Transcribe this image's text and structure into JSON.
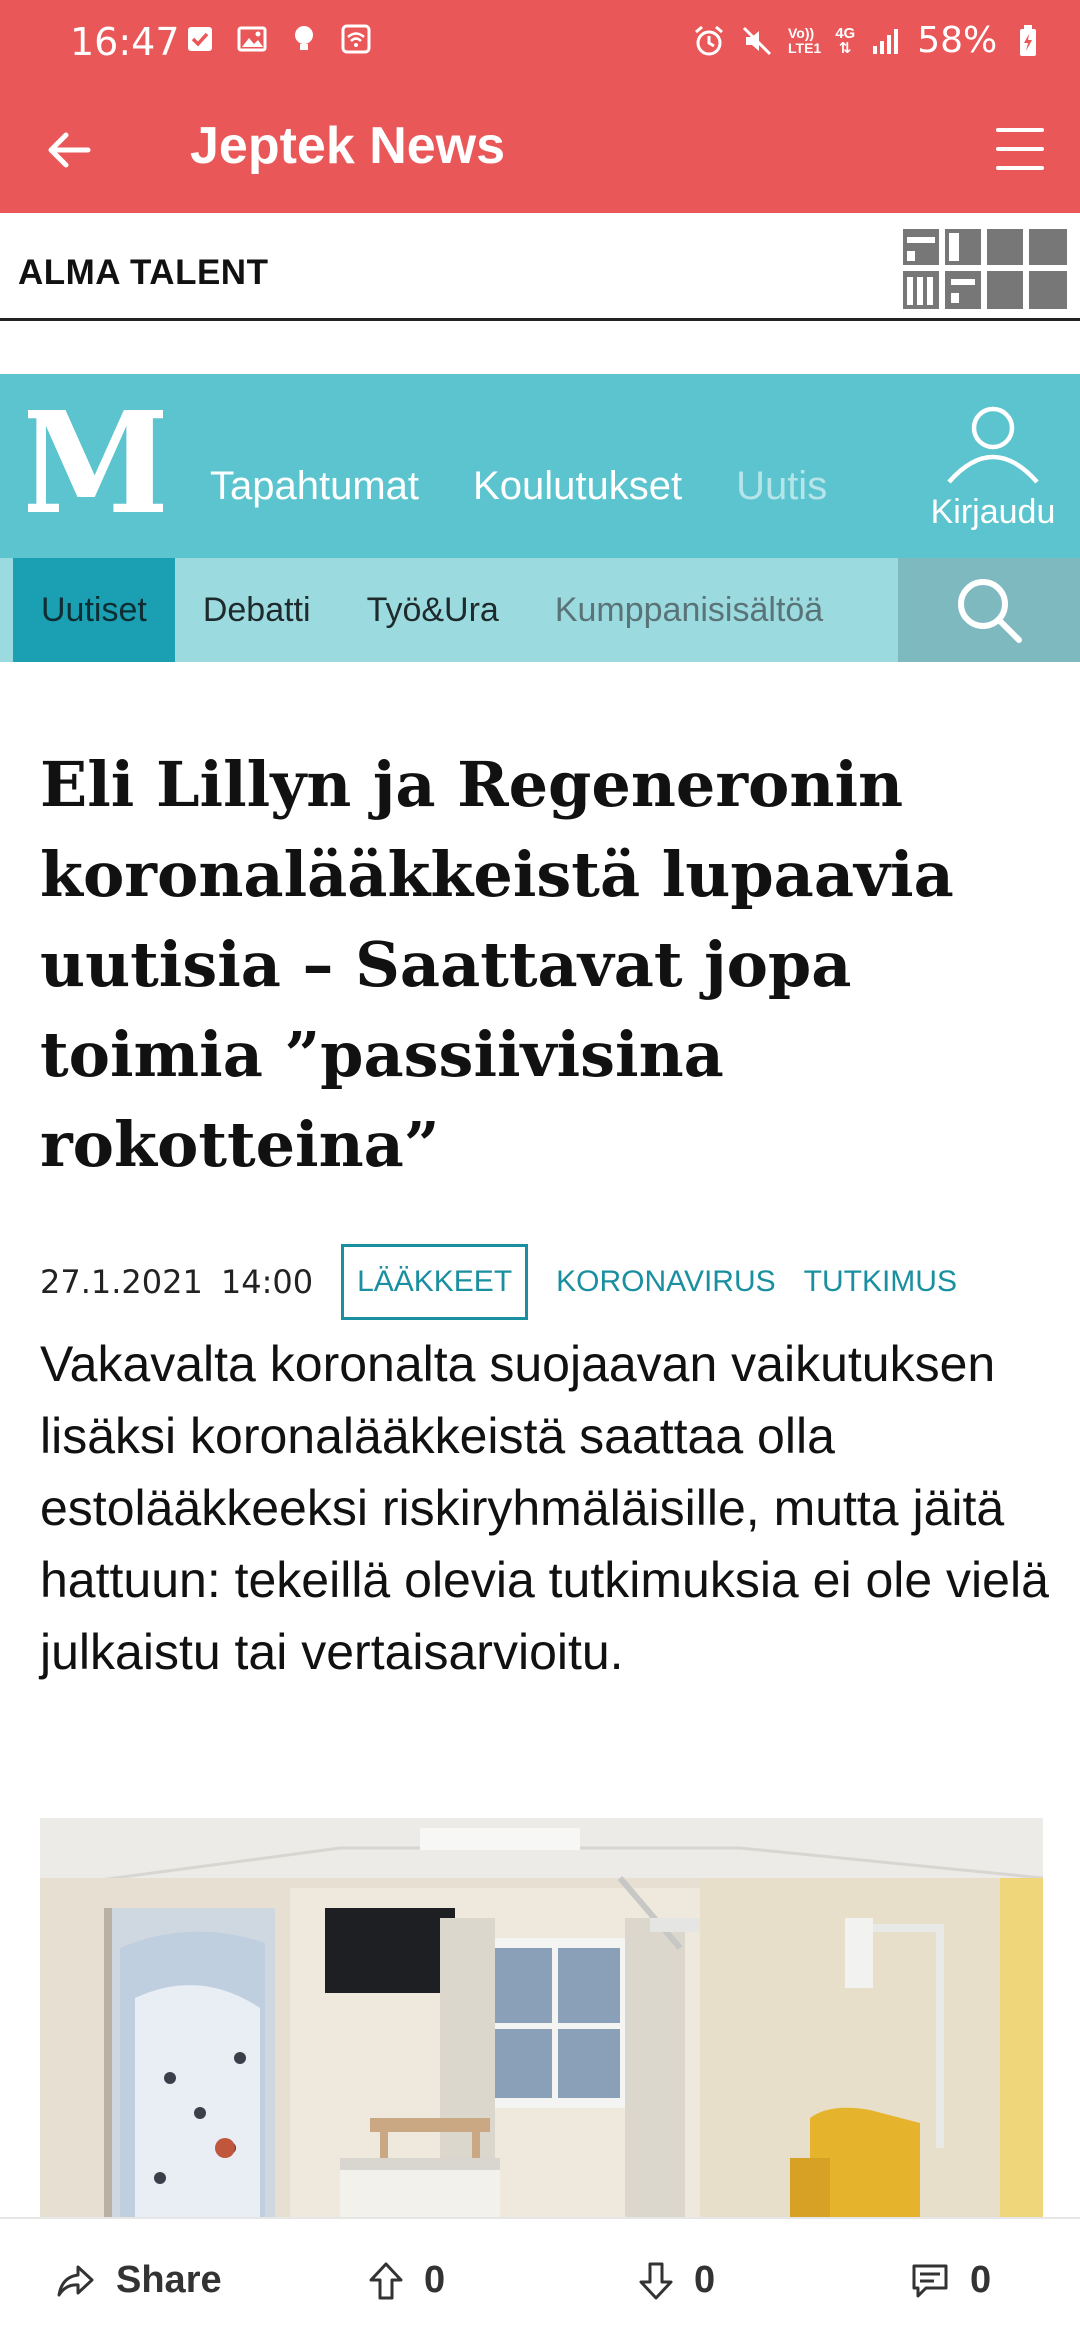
{
  "status_bar": {
    "time": "16:47",
    "battery": "58%",
    "network_top": "Vo))",
    "network_bottom": "LTE1",
    "network_4g": "4G"
  },
  "app_bar": {
    "title": "Jeptek News",
    "bg_color": "#ea5758"
  },
  "alma_strip": {
    "brand": "ALMA TALENT"
  },
  "site_header": {
    "logo_letter": "M",
    "nav": [
      "Tapahtumat",
      "Koulutukset",
      "Uutis"
    ],
    "login_label": "Kirjaudu",
    "bg_color": "#5bc4cf"
  },
  "sub_nav": {
    "tabs": [
      "Uutiset",
      "Debatti",
      "Työ&Ura",
      "Kumppanisisältöä"
    ],
    "active": "Uutiset"
  },
  "article": {
    "headline": "Eli Lillyn ja Regeneronin koronalääkkeistä lupaavia uutisia – Saattavat jopa toimia ”passiivisina rokotteina”",
    "date": "27.1.2021",
    "time": "14:00",
    "tags": [
      "LÄÄKKEET",
      "KORONAVIRUS",
      "TUTKIMUS"
    ],
    "lead": "Vakavalta koronalta suojaavan vaikutuksen lisäksi koronalääkkeistä saattaa olla estolääkkeeksi riskiryhmäläisille, mutta jäitä hattuun: tekeillä olevia tutkimuksia ei ole vielä julkaistu tai vertaisarvioitu."
  },
  "action_bar": {
    "share_label": "Share",
    "upvotes": "0",
    "downvotes": "0",
    "comments": "0"
  }
}
